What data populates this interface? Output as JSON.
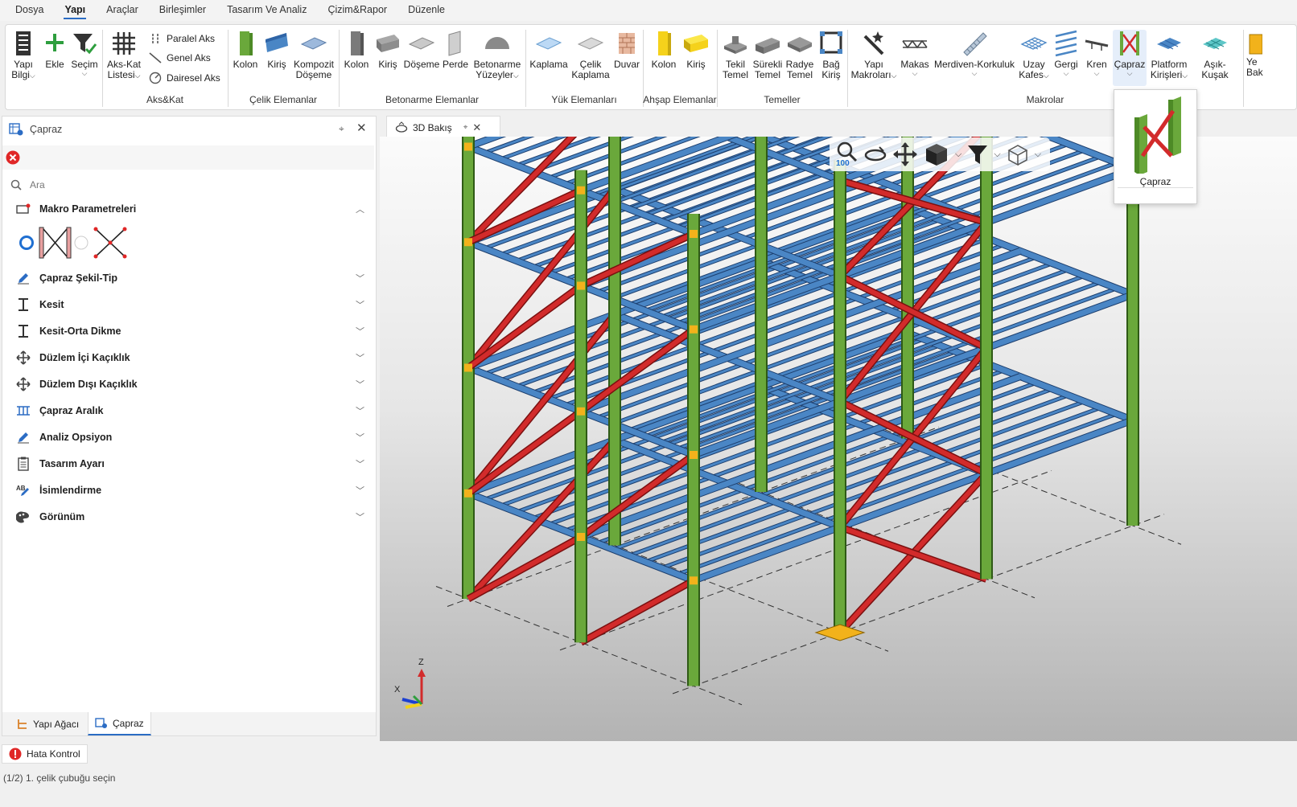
{
  "menu": {
    "items": [
      {
        "label": "Dosya",
        "active": false
      },
      {
        "label": "Yapı",
        "active": true
      },
      {
        "label": "Araçlar",
        "active": false
      },
      {
        "label": "Birleşimler",
        "active": false
      },
      {
        "label": "Tasarım Ve Analiz",
        "active": false
      },
      {
        "label": "Çizim&Rapor",
        "active": false
      },
      {
        "label": "Düzenle",
        "active": false
      }
    ]
  },
  "ribbon": {
    "yapi_bilgi": "Yapı\nBilgi",
    "ekle": "Ekle",
    "secim": "Seçim",
    "aks_kat_listesi": "Aks-Kat\nListesi",
    "paralel_aks": "Paralel Aks",
    "genel_aks": "Genel Aks",
    "dairesel_aks": "Dairesel Aks",
    "group_akskat": "Aks&Kat",
    "celik_kolon": "Kolon",
    "celik_kiris": "Kiriş",
    "kompozit_doseme": "Kompozit\nDöşeme",
    "group_celik": "Çelik Elemanlar",
    "bet_kolon": "Kolon",
    "bet_kiris": "Kiriş",
    "bet_doseme": "Döşeme",
    "bet_perde": "Perde",
    "bet_yuzeyler": "Betonarme\nYüzeyler",
    "group_betonarme": "Betonarme Elemanlar",
    "kaplama": "Kaplama",
    "celik_kaplama": "Çelik\nKaplama",
    "duvar": "Duvar",
    "group_yuk": "Yük Elemanları",
    "ahsap_kolon": "Kolon",
    "ahsap_kiris": "Kiriş",
    "group_ahsap": "Ahşap Elemanlar",
    "tekil_temel": "Tekil\nTemel",
    "surekli_temel": "Sürekli\nTemel",
    "radye_temel": "Radye\nTemel",
    "bag_kiris": "Bağ\nKiriş",
    "group_temeller": "Temeller",
    "yapi_makrolar": "Yapı\nMakroları",
    "makas": "Makas",
    "merdiven": "Merdiven-Korkuluk",
    "uzay_kafes": "Uzay\nKafes",
    "gergi": "Gergi",
    "kren": "Kren",
    "capraz": "Çapraz",
    "platform": "Platform\nKirişleri",
    "asik_kusak": "Aşık-Kuşak",
    "ye_bak": "Ye\nBak",
    "group_makrolar": "Makrolar"
  },
  "popup": {
    "label": "Çapraz"
  },
  "panel": {
    "title": "Çapraz",
    "search_placeholder": "Ara",
    "makro_parametreleri": "Makro Parametreleri",
    "sections": [
      "Çapraz Şekil-Tip",
      "Kesit",
      "Kesit-Orta Dikme",
      "Düzlem İçi Kaçıklık",
      "Düzlem Dışı Kaçıklık",
      "Çapraz Aralık",
      "Analiz Opsiyon",
      "Tasarım Ayarı",
      "İsimlendirme",
      "Görünüm"
    ]
  },
  "bottom_tabs": {
    "yapi_agaci": "Yapı Ağacı",
    "capraz": "Çapraz"
  },
  "hata_kontrol": "Hata Kontrol",
  "status_text": "(1/2) 1. çelik çubuğu seçin",
  "doc_tab": "3D Bakış",
  "view_toolbar": {
    "zoom_level": "100"
  },
  "axes": {
    "z": "Z",
    "x": "X"
  },
  "colors": {
    "column": "#6aa83b",
    "beam": "#4a86c5",
    "brace": "#d22b2b",
    "plate": "#f2b21b",
    "accent": "#2b6cc4"
  }
}
